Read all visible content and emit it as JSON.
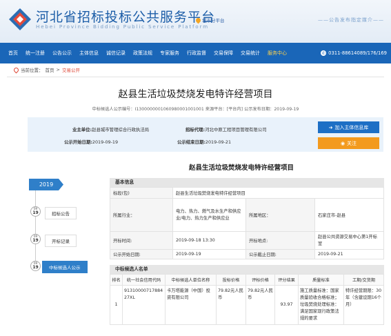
{
  "header": {
    "title": "河北省招标投标公共服务平台",
    "subtitle": "Hebei Province Bidding Public Service Platform",
    "city_switch": "城市分平台",
    "slogan": "——公告发布指定媒介——"
  },
  "nav": {
    "items": [
      "首页",
      "统一注册",
      "公告公示",
      "主体信息",
      "诚信记录",
      "政策法规",
      "专家服务",
      "行政监督",
      "交易保障",
      "交易统计",
      "服务中心"
    ],
    "highlight_index": 10,
    "hotline": "0311-88614089/176/169"
  },
  "breadcrumb": {
    "prefix": "当前位置：",
    "home": "首页",
    "sep": ">",
    "current": "交易公开"
  },
  "project": {
    "title": "赵县生活垃圾焚烧发电特许经营项目",
    "meta": "中标候选人公示编号：I1300000001060980001001001   来源平台：[平台内]   公示发布日期：2019-09-19"
  },
  "info": {
    "owner_label": "业主单位:",
    "owner": "赵县城市管理综合行政执法局",
    "agent_label": "招标代理:",
    "agent": "河北中原工程项目管理有限公司",
    "start_label": "公示开始日期:",
    "start": "2019-09-19",
    "end_label": "公示结束日期:",
    "end": "2019-09-21",
    "add_button": "加入主体信息库",
    "follow_button": "关注"
  },
  "section": {
    "title": "赵县生活垃圾焚烧发电特许经营项目"
  },
  "timeline": {
    "year": "2019",
    "nodes": [
      {
        "month": "09",
        "day": "19",
        "label": "招标公告"
      },
      {
        "month": "09",
        "day": "19",
        "label": "开标记录"
      },
      {
        "month": "09",
        "day": "19",
        "label": "中标候选人公示"
      }
    ]
  },
  "basic": {
    "head": "基本信息",
    "section_label": "标段(包)",
    "section_value": "赵县生活垃圾焚烧发电特许经营项目",
    "industry_label": "所属行业：",
    "industry_value": "电力、热力、燃气及水生产和供应业/电力、热力生产和供应业",
    "region_label": "所属地区：",
    "region_value": "石家庄市-赵县",
    "open_time_label": "开标时间:",
    "open_time": "2019-09-18 13:30",
    "open_place_label": "开标地点:",
    "open_place": "赵县公共资源交易中心第1开标室",
    "pub_start_label": "公示开始日期:",
    "pub_start": "2019-09-19",
    "pub_end_label": "公示截止日期:",
    "pub_end": "2019-09-21"
  },
  "candidates": {
    "head": "中标候选人名单",
    "columns": [
      "排名",
      "统一社会信用代码",
      "中标候选人单位名称",
      "投标价格",
      "评标价格",
      "评分结果",
      "质量标准",
      "工期/交货期"
    ],
    "rows": [
      [
        "1",
        "91310000717884 27XL",
        "卡万塔能源（中国）投资有限公司",
        "79.82元人民币",
        "79.82元人民币",
        "93.97",
        "施工质量标准：国家质量验收合格标准；垃圾焚烧处理标准：满足国家现行政策法规的要求",
        "特许经营期限：30年（含建设期16个月）"
      ]
    ]
  }
}
